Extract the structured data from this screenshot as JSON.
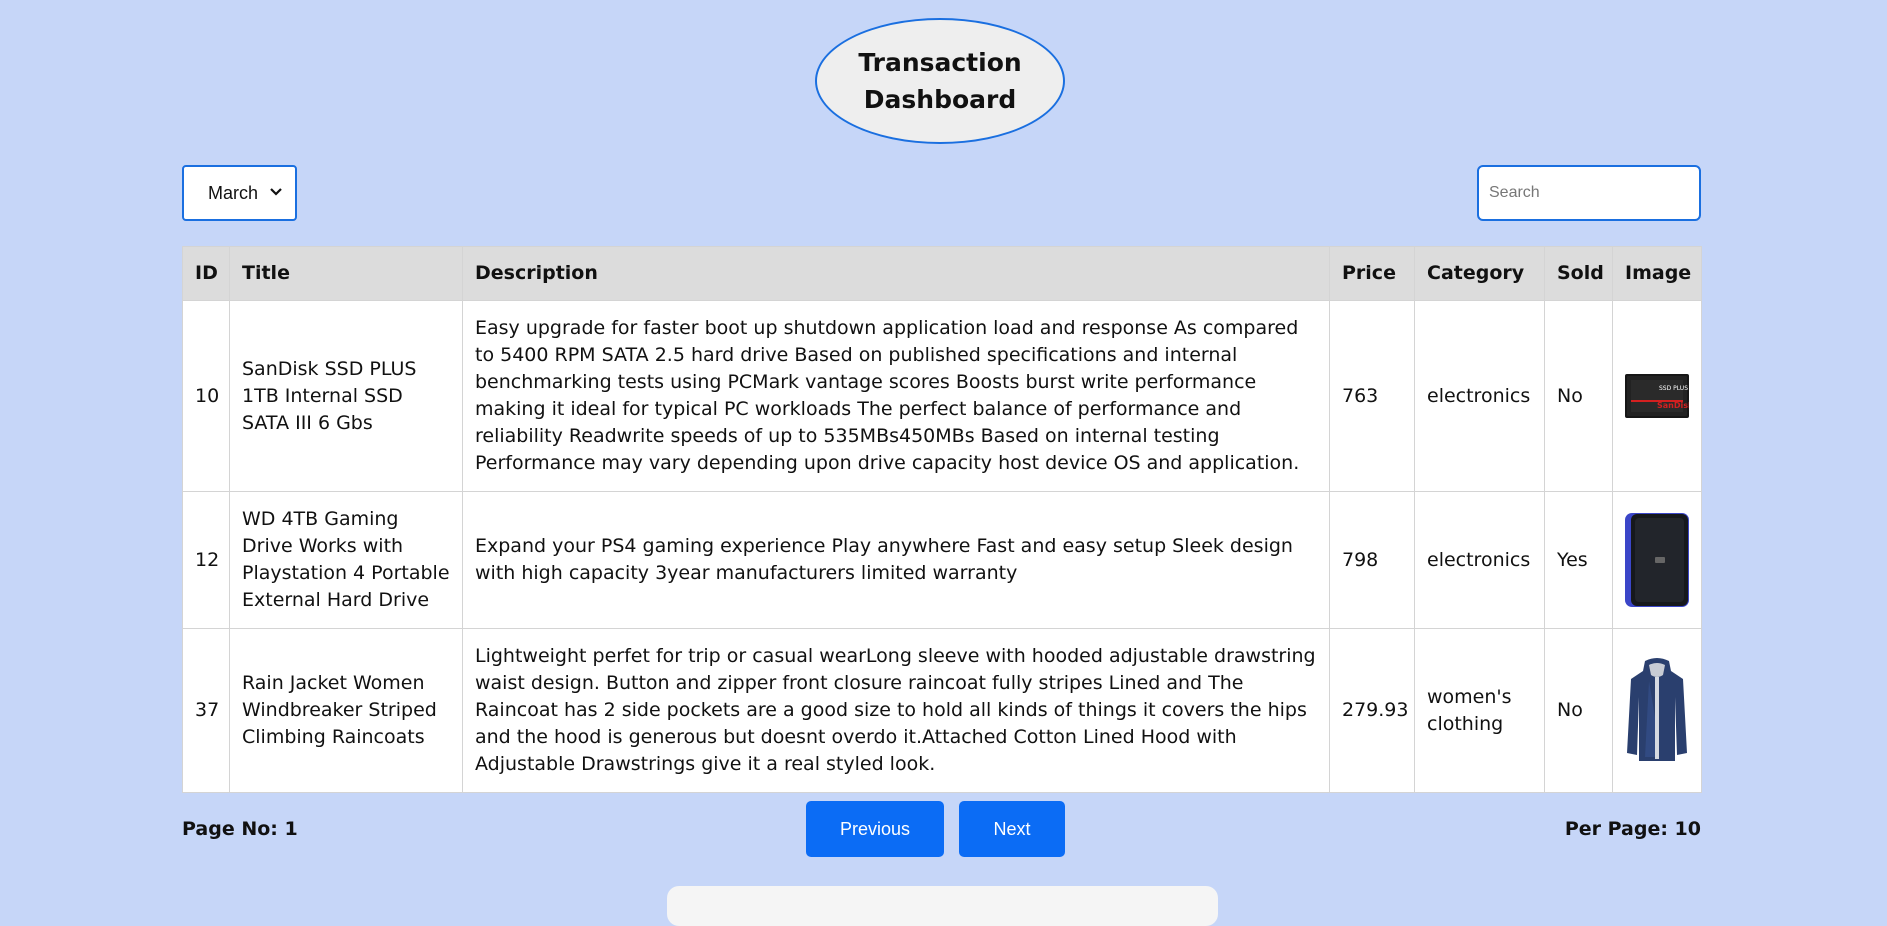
{
  "header": {
    "title": "Transaction Dashboard"
  },
  "filters": {
    "month_selected": "March",
    "search_placeholder": "Search"
  },
  "table": {
    "columns": [
      "ID",
      "Title",
      "Description",
      "Price",
      "Category",
      "Sold",
      "Image"
    ],
    "rows": [
      {
        "id": "10",
        "title": "SanDisk SSD PLUS 1TB Internal SSD SATA III 6 Gbs",
        "description": "Easy upgrade for faster boot up shutdown application load and response As compared to 5400 RPM SATA 2.5 hard drive Based on published specifications and internal benchmarking tests using PCMark vantage scores Boosts burst write performance making it ideal for typical PC workloads The perfect balance of performance and reliability Readwrite speeds of up to 535MBs450MBs Based on internal testing Performance may vary depending upon drive capacity host device OS and application.",
        "price": "763",
        "category": "electronics",
        "sold": "No",
        "image_icon": "ssd-image"
      },
      {
        "id": "12",
        "title": "WD 4TB Gaming Drive Works with Playstation 4 Portable External Hard Drive",
        "description": "Expand your PS4 gaming experience Play anywhere Fast and easy setup Sleek design with high capacity 3year manufacturers limited warranty",
        "price": "798",
        "category": "electronics",
        "sold": "Yes",
        "image_icon": "hard-drive-image"
      },
      {
        "id": "37",
        "title": "Rain Jacket Women Windbreaker Striped Climbing Raincoats",
        "description": "Lightweight perfet for trip or casual wearLong sleeve with hooded adjustable drawstring waist design. Button and zipper front closure raincoat fully stripes Lined and The Raincoat has 2 side pockets are a good size to hold all kinds of things it covers the hips and the hood is generous but doesnt overdo it.Attached Cotton Lined Hood with Adjustable Drawstrings give it a real styled look.",
        "price": "279.93",
        "category": "women's clothing",
        "sold": "No",
        "image_icon": "jacket-image"
      }
    ]
  },
  "pagination": {
    "page_label": "Page No: 1",
    "per_page_label": "Per Page: 10",
    "previous_label": "Previous",
    "next_label": "Next"
  },
  "colors": {
    "background": "#c6d6f8",
    "accent": "#0b6cf5",
    "border_accent": "#1a6fe0"
  }
}
